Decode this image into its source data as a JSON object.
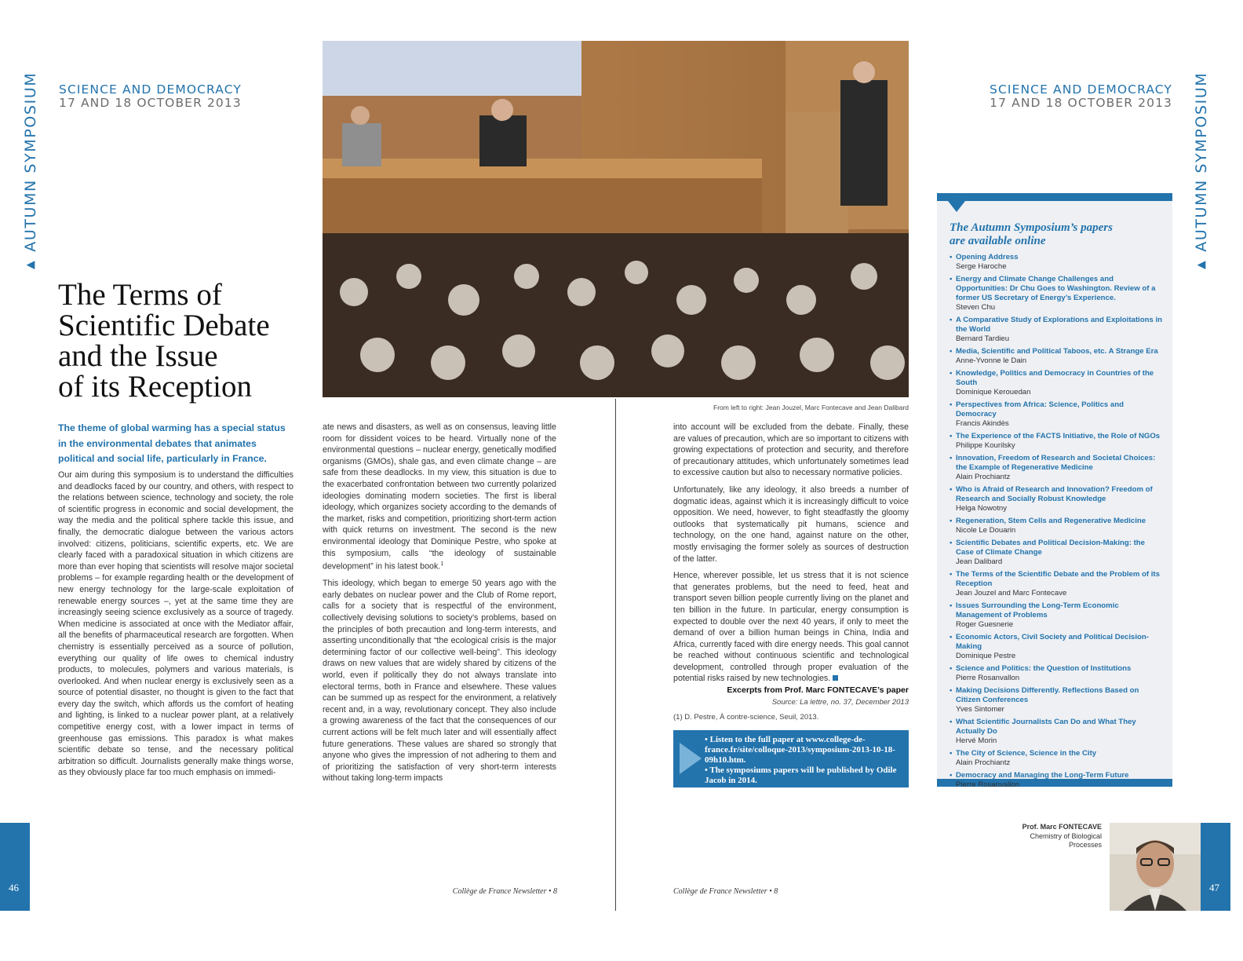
{
  "section_label": "AUTUMN SYMPOSIUM",
  "kicker": {
    "line1": "SCIENCE AND DEMOCRACY",
    "line2": "17 AND 18 OCTOBER 2013"
  },
  "title_lines": [
    "The Terms of",
    "Scientific Debate",
    "and the Issue",
    "of its Reception"
  ],
  "lead": "The theme of global warming has a special status in the environmental debates that animates political and social life, particularly in France.",
  "col1_text": "Our aim during this symposium is to understand the difficulties and deadlocks faced by our country, and others, with respect to the relations between science, technology and society, the role of scientific progress in economic and social development, the way the media and the political sphere tackle this issue, and finally, the democratic dialogue between the various actors involved: citizens, politicians, scientific experts, etc. We are clearly faced with a paradoxical situation in which citizens are more than ever hoping that scientists will resolve major societal problems – for example regarding health or the development of new energy technology for the large-scale exploitation of renewable energy sources –, yet at the same time they are increasingly seeing science exclusively as a source of tragedy. When medicine is associated at once with the Mediator affair, all the benefits of pharmaceutical research are forgotten. When chemistry is essentially perceived as a source of pollution, everything our quality of life owes to chemical industry products, to molecules, polymers and various materials, is overlooked. And when nuclear energy is exclusively seen as a source of potential disaster, no thought is given to the fact that every day the switch, which affords us the comfort of heating and lighting, is linked to a nuclear power plant, at a relatively competitive energy cost, with a lower impact in terms of greenhouse gas emissions. This paradox is what makes scientific debate so tense, and the necessary political arbitration so difficult. Journalists generally make things worse, as they obviously place far too much emphasis on immedi-",
  "col2_p1": "ate news and disasters, as well as on consensus, leaving little room for dissident voices to be heard. Virtually none of the environmental questions – nuclear energy, genetically modified organisms (GMOs), shale gas, and even climate change – are safe from these deadlocks. In my view, this situation is due to the exacerbated confrontation between two currently polarized ideologies dominating modern societies. The first is liberal ideology, which organizes society according to the demands of the market, risks and competition, prioritizing short-term action with quick returns on investment. The second is the new environmental ideology that Dominique Pestre, who spoke at this symposium, calls “the ideology of sustainable development” in his latest book.",
  "col2_p1_sup": "1",
  "col2_p2": "This ideology, which began to emerge 50 years ago with the early debates on nuclear power and the Club of Rome report, calls for a society that is respectful of the environment, collectively devising solutions to society’s problems, based on the principles of both precaution and long-term interests, and asserting unconditionally that “the ecological crisis is the major determining factor of our collective well-being”. This ideology draws on new values that are widely shared by citizens of the world, even if politically they do not always translate into electoral terms, both in France and elsewhere. These values can be summed up as respect for the environment, a relatively recent and, in a way, revolutionary concept. They also include a growing awareness of the fact that the consequences of our current actions will be felt much later and will essentially affect future generations. These values are shared so strongly that anyone who gives the impression of not adhering to them and of prioritizing the satisfaction of very short-term interests without taking long-term impacts",
  "photo_caption": "From left to right: Jean Jouzel, Marc Fontecave and Jean Dalibard",
  "col3_p1": "into account will be excluded from the debate. Finally, these are values of precaution, which are so important to citizens with growing expectations of protection and security, and therefore of precautionary attitudes, which unfortunately sometimes lead to excessive caution but also to necessary normative policies.",
  "col3_p2": "Unfortunately, like any ideology, it also breeds a number of dogmatic ideas, against which it is increasingly difficult to voice opposition. We need, however, to fight steadfastly the gloomy outlooks that systematically pit humans, science and technology, on the one hand, against nature on the other, mostly envisaging the former solely as sources of destruction of the latter.",
  "col3_p3": "Hence, wherever possible, let us stress that it is not science that generates problems, but the need to feed, heat and transport seven billion people currently living on the planet and ten billion in the future. In particular, energy consumption is expected to double over the next 40 years, if only to meet the demand of over a billion human beings in China, India and Africa, currently faced with dire energy needs. This goal cannot be reached without continuous scientific and technological development, controlled through proper evaluation of the potential risks raised by new technologies.",
  "excerpt": "Excerpts from Prof. Marc FONTECAVE’s paper",
  "source": "Source: La lettre, no. 37, December 2013",
  "footnote": "(1) D. Pestre, À contre-science, Seuil, 2013.",
  "bluebox": {
    "item1": "• Listen to the full paper at www.college-de-france.fr/site/colloque-2013/symposium-2013-10-18-09h10.htm.",
    "item2": "• The symposiums papers will be published by Odile Jacob in 2014."
  },
  "sidebar": {
    "title": "The Autumn Symposium’s papers are available online",
    "items": [
      {
        "title": "Opening Address",
        "author": "Serge Haroche"
      },
      {
        "title": "Energy and Climate Change Challenges and Opportunities: Dr Chu Goes to Washington. Review of a former US Secretary of Energy’s Experience.",
        "author": "Steven Chu"
      },
      {
        "title": "A Comparative Study of Explorations and Exploitations in the World",
        "author": "Bernard Tardieu"
      },
      {
        "title": "Media, Scientific and Political Taboos, etc. A Strange Era",
        "author": "Anne-Yvonne le Dain"
      },
      {
        "title": "Knowledge, Politics and Democracy in Countries of the South",
        "author": "Dominique Kerouedan"
      },
      {
        "title": "Perspectives from Africa: Science, Politics and Democracy",
        "author": "Francis Akindès"
      },
      {
        "title": "The Experience of the FACTS Initiative, the Role of NGOs",
        "author": "Philippe Kourilsky"
      },
      {
        "title": "Innovation, Freedom of Research and Societal Choices: the Example of Regenerative Medicine",
        "author": "Alain Prochiantz"
      },
      {
        "title": "Who is Afraid of Research and Innovation? Freedom of Research and Socially Robust Knowledge",
        "author": "Helga Nowotny"
      },
      {
        "title": "Regeneration, Stem Cells and Regenerative Medicine",
        "author": "Nicole Le Douarin"
      },
      {
        "title": "Scientific Debates and Political Decision-Making: the Case of Climate Change",
        "author": "Jean Dalibard"
      },
      {
        "title": "The Terms of the Scientific Debate and the Problem of its Reception",
        "author": "Jean Jouzel and Marc Fontecave"
      },
      {
        "title": "Issues Surrounding the Long-Term Economic Management of Problems",
        "author": "Roger Guesnerie"
      },
      {
        "title": "Economic Actors, Civil Society and Political Decision-Making",
        "author": "Dominique Pestre"
      },
      {
        "title": "Science and Politics: the Question of Institutions",
        "author": "Pierre Rosanvallon"
      },
      {
        "title": "Making Decisions Differently. Reflections Based on Citizen Conferences",
        "author": "Yves Sintomer"
      },
      {
        "title": "What Scientific Journalists Can Do and What They Actually Do",
        "author": "Hervé Morin"
      },
      {
        "title": "The City of Science, Science in the City",
        "author": "Alain Prochiantz"
      },
      {
        "title": "Democracy and Managing the Long-Term Future",
        "author": "Pierre Rosanvallon"
      }
    ]
  },
  "profile": {
    "name": "Prof. Marc FONTECAVE",
    "line1": "Chemistry of Biological",
    "line2": "Processes"
  },
  "footer_left": "Collège de France Newsletter • 8",
  "footer_right": "Collège de France Newsletter • 8",
  "page_left": "46",
  "page_right": "47",
  "colors": {
    "accent": "#2373ac"
  }
}
